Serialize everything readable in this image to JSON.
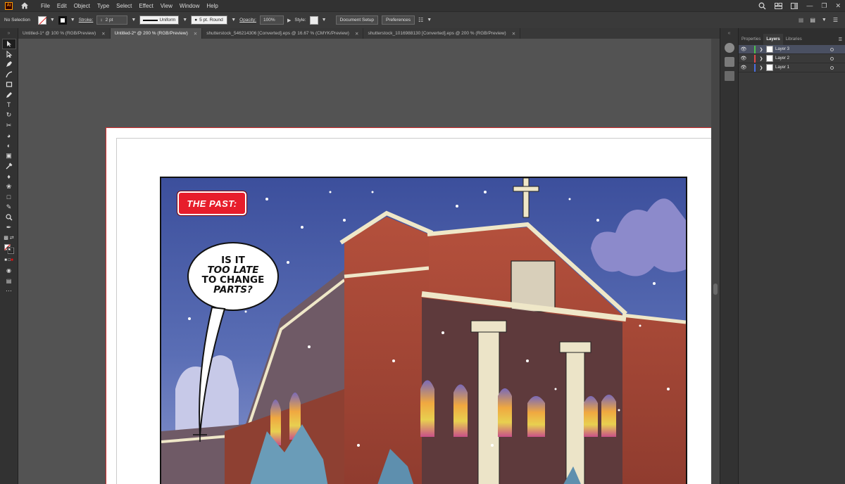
{
  "app": {
    "logo": "Ai",
    "menu": [
      "File",
      "Edit",
      "Object",
      "Type",
      "Select",
      "Effect",
      "View",
      "Window",
      "Help"
    ]
  },
  "controlbar": {
    "selection": "No Selection",
    "stroke_label": "Stroke:",
    "stroke_weight": "2 pt",
    "profile": "Uniform",
    "brush": "5 pt. Round",
    "opacity_label": "Opacity:",
    "opacity": "100%",
    "style_label": "Style:",
    "document_setup": "Document Setup",
    "preferences": "Preferences"
  },
  "tabs": [
    {
      "label": "Untitled-1* @ 100 % (RGB/Preview)"
    },
    {
      "label": "Untitled-2* @ 200 % (RGB/Preview)"
    },
    {
      "label": "shutterstock_546214306 [Converted].eps @ 16.67 % (CMYK/Preview)"
    },
    {
      "label": "shutterstock_1016988130 [Converted].eps @ 200 % (RGB/Preview)"
    }
  ],
  "artwork": {
    "caption": "THE PAST:",
    "bubble": {
      "line1": "IS IT",
      "line2": "TOO LATE",
      "line3": "TO CHANGE",
      "line4": "PARTS?"
    }
  },
  "layers_panel": {
    "tabs": [
      "Properties",
      "Layers",
      "Libraries"
    ],
    "layers": [
      {
        "name": "Layer 3",
        "color": "#4ec24e"
      },
      {
        "name": "Layer 2",
        "color": "#e04a4a"
      },
      {
        "name": "Layer 1",
        "color": "#4a6ee0"
      }
    ]
  }
}
